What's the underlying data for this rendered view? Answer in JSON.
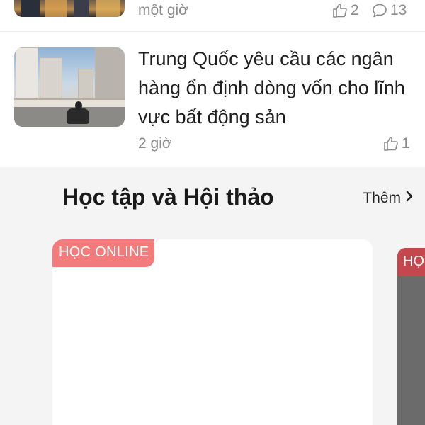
{
  "top_article": {
    "time": "một giờ",
    "likes": "2",
    "comments": "13"
  },
  "article": {
    "title": "Trung Quốc yêu cầu các ngân hàng ổn định dòng vốn cho lĩnh vực bất động sản",
    "time": "2 giờ",
    "likes": "1"
  },
  "section": {
    "title": "Học tập và Hội thảo",
    "more_label": "Thêm",
    "cards": [
      {
        "badge": "HỌC ONLINE"
      },
      {
        "badge": "HỌ"
      }
    ]
  },
  "colors": {
    "badge_primary": "#f27b7b",
    "badge_secondary": "#c3474c",
    "section_bg": "#f4f4f4",
    "meta_text": "#8a8a8a"
  },
  "icons": {
    "like": "thumbs-up-icon",
    "comment": "comment-bubble-icon",
    "more": "chevron-right-icon"
  }
}
